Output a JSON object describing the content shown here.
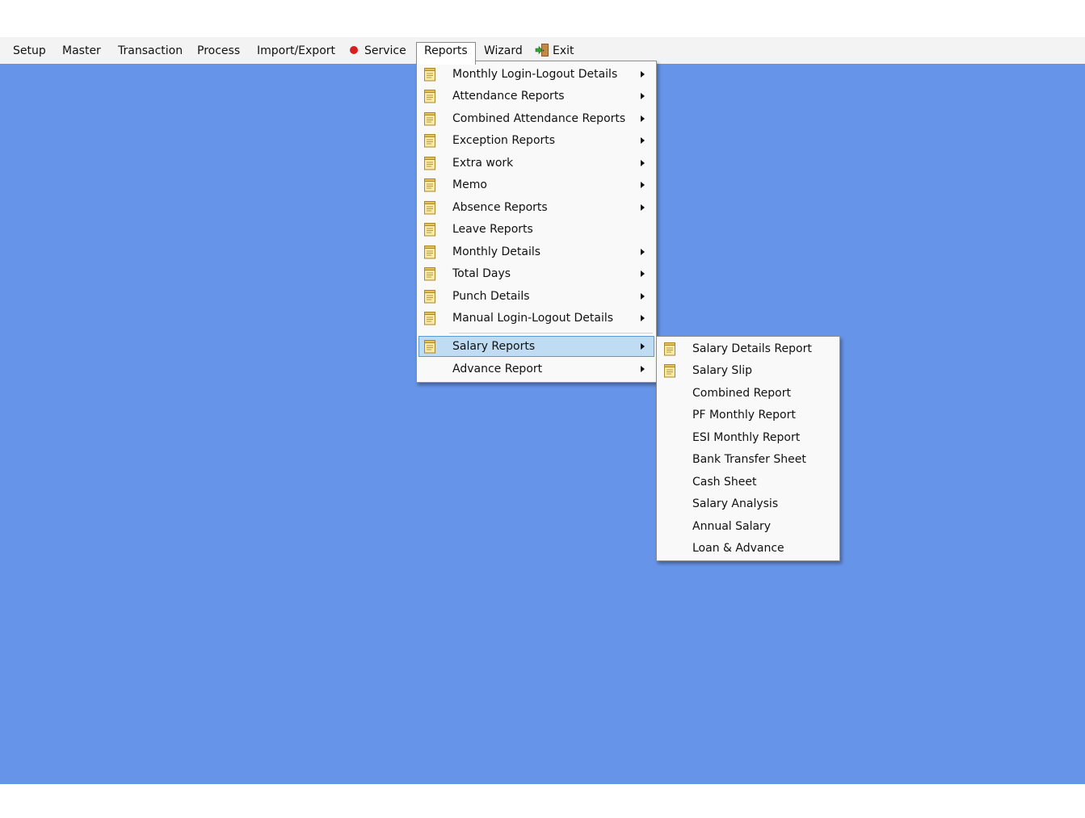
{
  "menubar": {
    "items": [
      {
        "label": "Setup"
      },
      {
        "label": "Master"
      },
      {
        "label": "Transaction"
      },
      {
        "label": "Process"
      },
      {
        "label": "Import/Export"
      },
      {
        "label": "Service",
        "icon": "red-dot-icon"
      },
      {
        "label": "Reports",
        "state": "open"
      },
      {
        "label": "Wizard"
      },
      {
        "label": "Exit",
        "icon": "exit-door-icon"
      }
    ]
  },
  "reports_menu": {
    "items": [
      {
        "label": "Monthly Login-Logout Details",
        "has_submenu": true
      },
      {
        "label": "Attendance Reports",
        "has_submenu": true
      },
      {
        "label": "Combined Attendance Reports",
        "has_submenu": true
      },
      {
        "label": "Exception Reports",
        "has_submenu": true
      },
      {
        "label": "Extra work",
        "has_submenu": true
      },
      {
        "label": "Memo",
        "has_submenu": true
      },
      {
        "label": "Absence Reports",
        "has_submenu": true
      },
      {
        "label": "Leave Reports",
        "has_submenu": false
      },
      {
        "label": "Monthly Details",
        "has_submenu": true
      },
      {
        "label": "Total Days",
        "has_submenu": true
      },
      {
        "label": "Punch Details",
        "has_submenu": true
      },
      {
        "label": "Manual Login-Logout Details",
        "has_submenu": true
      },
      {
        "label": "Salary Reports",
        "has_submenu": true,
        "highlighted": true
      },
      {
        "label": "Advance Report",
        "has_submenu": true
      }
    ]
  },
  "salary_submenu": {
    "items": [
      {
        "label": "Salary Details Report",
        "icon": "report-icon"
      },
      {
        "label": "Salary Slip",
        "icon": "report-icon"
      },
      {
        "label": "Combined Report"
      },
      {
        "label": "PF Monthly Report"
      },
      {
        "label": "ESI Monthly Report"
      },
      {
        "label": "Bank Transfer Sheet"
      },
      {
        "label": "Cash Sheet"
      },
      {
        "label": "Salary Analysis"
      },
      {
        "label": "Annual Salary"
      },
      {
        "label": "Loan & Advance"
      }
    ]
  },
  "colors": {
    "desktop": "#6694e8",
    "menubar": "#f3f3f3",
    "highlight": "#c0dcf3",
    "highlight_border": "#5b9bd5",
    "service_dot": "#d62020"
  }
}
